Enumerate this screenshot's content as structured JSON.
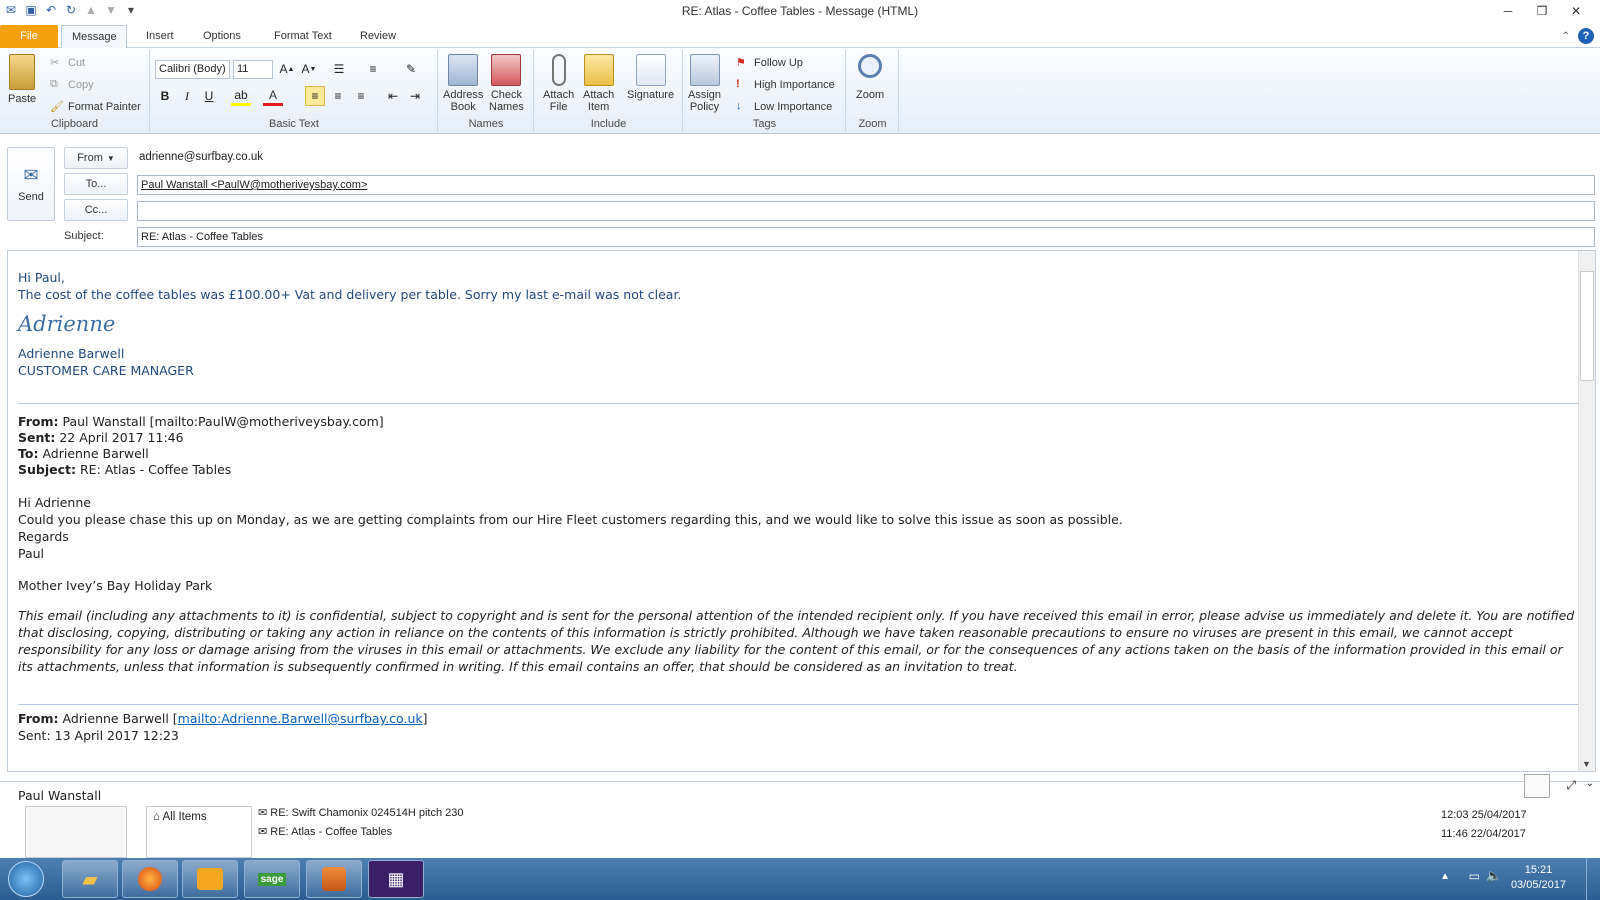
{
  "window": {
    "title": "RE: Atlas - Coffee Tables  -  Message (HTML)"
  },
  "tabs": [
    "File",
    "Message",
    "Insert",
    "Options",
    "Format Text",
    "Review"
  ],
  "ribbon": {
    "clipboard": {
      "label": "Clipboard",
      "paste": "Paste",
      "cut": "Cut",
      "copy": "Copy",
      "format_painter": "Format Painter"
    },
    "basic_text": {
      "label": "Basic Text",
      "font": "Calibri (Body)",
      "font_size": "11"
    },
    "names": {
      "label": "Names",
      "address_book": "Address\nBook",
      "check_names": "Check\nNames"
    },
    "include": {
      "label": "Include",
      "attach_file": "Attach\nFile",
      "attach_item": "Attach\nItem",
      "signature": "Signature"
    },
    "tags": {
      "label": "Tags",
      "assign_policy": "Assign\nPolicy",
      "follow_up": "Follow Up",
      "high_importance": "High Importance",
      "low_importance": "Low Importance"
    },
    "zoom": {
      "label": "Zoom",
      "zoom": "Zoom"
    }
  },
  "header": {
    "send": "Send",
    "from_btn": "From",
    "from_value": "adrienne@surfbay.co.uk",
    "to_btn": "To...",
    "to_value": "Paul Wanstall <PaulW@motheriveysbay.com>",
    "cc_btn": "Cc...",
    "cc_value": "",
    "subject_label": "Subject:",
    "subject_value": "RE: Atlas - Coffee Tables"
  },
  "body": {
    "greeting": "Hi Paul,",
    "line1": "The cost of the coffee tables was £100.00+ Vat and delivery per table.  Sorry my last e-mail was not clear.",
    "signature_script": "Adrienne",
    "sig_name": "Adrienne Barwell",
    "sig_title": "CUSTOMER CARE MANAGER",
    "q1": {
      "from_label": "From:",
      "from": "Paul Wanstall [mailto:PaulW@motheriveysbay.com]",
      "sent_label": "Sent:",
      "sent": "22 April 2017 11:46",
      "to_label": "To:",
      "to": "Adrienne Barwell",
      "subject_label": "Subject:",
      "subject": "RE: Atlas - Coffee Tables",
      "greeting": "Hi Adrienne",
      "text": "Could you please chase this up on Monday, as we are getting complaints from our Hire Fleet customers regarding this, and we would like to solve this issue as soon as possible.",
      "regards": "Regards",
      "name": "Paul",
      "company": "Mother Ivey’s Bay Holiday Park",
      "disclaimer": "This email (including any attachments to it) is confidential, subject to copyright and is sent for the personal attention of the intended recipient only. If you have received this email in error, please advise us immediately and delete it. You are notified that disclosing, copying, distributing or taking any action in reliance on the contents of this information is strictly prohibited. Although we have taken reasonable precautions to ensure no viruses are present in this email, we cannot accept responsibility for any loss or damage arising from the viruses in this email or attachments. We exclude any liability for the content of this email, or for the consequences of any actions taken on the basis of the information provided in this email or its attachments, unless that information is subsequently confirmed in writing. If this email contains an offer, that should be considered as an invitation to treat."
    },
    "q2": {
      "from_label": "From:",
      "from_name": "Adrienne Barwell",
      "from_link": "mailto:Adrienne.Barwell@surfbay.co.uk",
      "sent_partial": "Sent: 13 April 2017 12:23"
    }
  },
  "people_pane": {
    "name": "Paul Wanstall",
    "all_items": "All Items",
    "items": [
      {
        "subject": "RE: Swift Chamonix 024514H pitch 230",
        "time": "12:03",
        "date": "25/04/2017"
      },
      {
        "subject": "RE: Atlas - Coffee Tables",
        "time": "11:46",
        "date": "22/04/2017"
      }
    ]
  },
  "taskbar": {
    "time": "15:21",
    "date": "03/05/2017",
    "sage_label": "sage"
  },
  "colors": {
    "file_tab": "#f5a00e",
    "body_blue": "#1f497d",
    "link": "#0563c1",
    "taskbar": "#2c5d92"
  }
}
